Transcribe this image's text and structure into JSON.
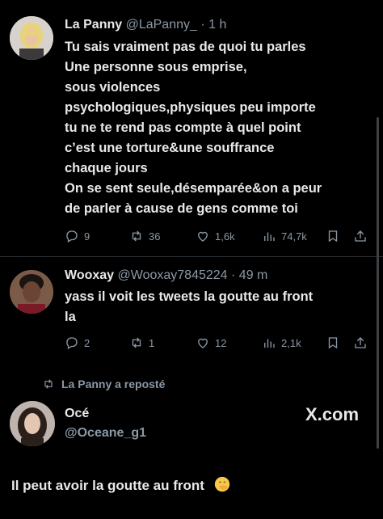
{
  "tweet1": {
    "name": "La Panny",
    "handle": "@LaPanny_",
    "time": "· 1 h",
    "lines": [
      "Tu sais vraiment pas de quoi tu parles",
      "Une personne sous emprise,",
      "sous violences",
      "psychologiques,physiques peu importe",
      "tu ne te rend pas compte à quel point",
      "c’est une torture&une souffrance",
      "chaque jours",
      "On se sent seule,désemparée&on a peur",
      "de parler à cause de gens comme toi"
    ],
    "stats": {
      "replies": "9",
      "reposts": "36",
      "likes": "1,6k",
      "views": "74,7k"
    },
    "icons": {
      "reply": "reply-icon",
      "repost": "repost-icon",
      "like": "heart-icon",
      "views": "views-icon",
      "bookmark": "bookmark-icon",
      "share": "share-icon"
    }
  },
  "tweet2": {
    "name": "Wooxay",
    "handle": "@Wooxay7845224",
    "time": "· 49 m",
    "lines": [
      "yass il voit les tweets la goutte au front",
      "la"
    ],
    "stats": {
      "replies": "2",
      "reposts": "1",
      "likes": "12",
      "views": "2,1k"
    }
  },
  "repost_banner": {
    "text": "La Panny a reposté"
  },
  "quoted": {
    "name": "Océ",
    "handle": "@Oceane_g1",
    "watermark": "X.com",
    "text": "Il peut avoir la goutte au front",
    "emoji": "face-with-hand-over-mouth"
  },
  "colors": {
    "background": "#000000",
    "text": "#e7e9ea",
    "muted": "#8b98a5",
    "divider": "#2f3336"
  }
}
